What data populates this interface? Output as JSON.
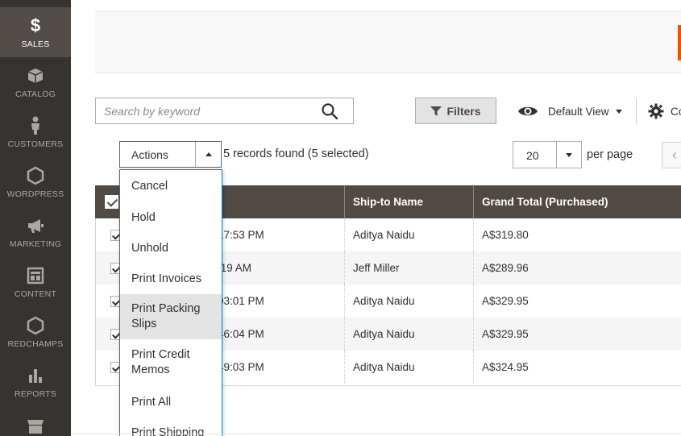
{
  "sidebar": {
    "items": [
      {
        "label": "SALES",
        "icon": "dollar-icon",
        "glyph": "$"
      },
      {
        "label": "CATALOG",
        "icon": "box-icon"
      },
      {
        "label": "CUSTOMERS",
        "icon": "person-icon"
      },
      {
        "label": "WORDPRESS",
        "icon": "hexagon-icon"
      },
      {
        "label": "MARKETING",
        "icon": "megaphone-icon"
      },
      {
        "label": "CONTENT",
        "icon": "layout-icon"
      },
      {
        "label": "REDCHAMPS",
        "icon": "hexagon-icon"
      },
      {
        "label": "REPORTS",
        "icon": "bar-chart-icon"
      },
      {
        "label": "",
        "icon": "store-icon"
      }
    ]
  },
  "toolbar": {
    "search_placeholder": "Search by keyword",
    "filters_label": "Filters",
    "view_label": "Default View",
    "columns_label": "Co"
  },
  "actions": {
    "label": "Actions",
    "records_found": "5 records found (5 selected)",
    "options": [
      "Cancel",
      "Hold",
      "Unhold",
      "Print Invoices",
      "Print Packing Slips",
      "Print Credit Memos",
      "Print All",
      "Print Shipping"
    ]
  },
  "pager": {
    "per_page_value": "20",
    "per_page_label": "per page",
    "prev_glyph": "‹"
  },
  "grid": {
    "columns": [
      "",
      "Ship-to Name",
      "Grand Total (Purchased)"
    ],
    "rows": [
      {
        "time": "17:53 PM",
        "ship_to": "Aditya Naidu",
        "total": "A$319.80"
      },
      {
        "time": ":19 AM",
        "ship_to": "Jeff Miller",
        "total": "A$289.96"
      },
      {
        "time": "03:01 PM",
        "ship_to": "Aditya Naidu",
        "total": "A$329.95"
      },
      {
        "time": "46:04 PM",
        "ship_to": "Aditya Naidu",
        "total": "A$329.95"
      },
      {
        "time": "49:03 PM",
        "ship_to": "Aditya Naidu",
        "total": "A$324.95"
      }
    ]
  },
  "colors": {
    "sidebar_bg": "#373330",
    "sidebar_active": "#524d49",
    "grid_header": "#514943",
    "accent": "#eb5202",
    "focus": "#007bdb"
  }
}
